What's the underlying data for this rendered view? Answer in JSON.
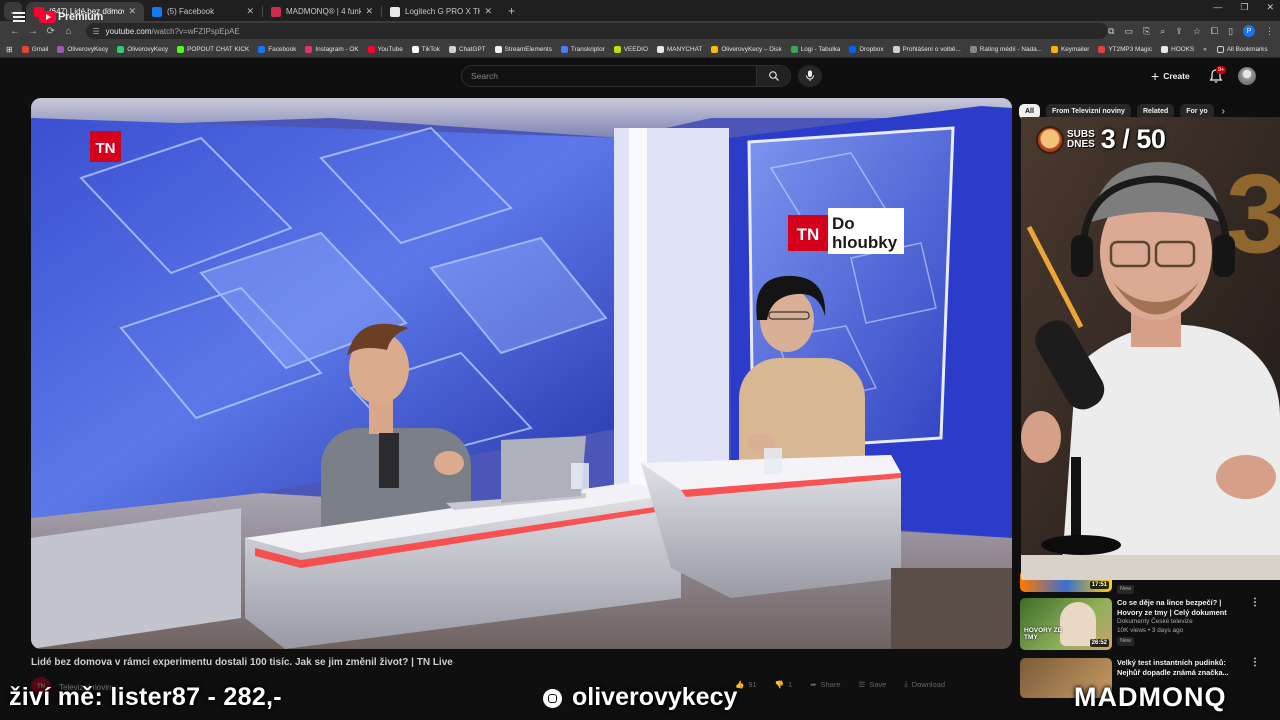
{
  "browser": {
    "tabs": [
      {
        "title": "(647) Lidé bez domova v rámci",
        "color": "#ff0033",
        "active": true
      },
      {
        "title": "(5) Facebook",
        "color": "#1877f2",
        "active": false
      },
      {
        "title": "MADMONQ® | 4 funkční doplň",
        "color": "#d12a4a",
        "active": false
      },
      {
        "title": "Logitech G PRO X TKL LIGHTSP",
        "color": "#e8e8e8",
        "active": false
      }
    ],
    "url_host": "youtube.com",
    "url_path": "/watch?v=wFZIPspEpAE",
    "profile_initial": "P",
    "bookmarks": [
      {
        "label": "Gmail",
        "color": "#ea4335"
      },
      {
        "label": "OliverovyKecy",
        "color": "#9b59b6"
      },
      {
        "label": "OliverovyKecy",
        "color": "#2ecc71"
      },
      {
        "label": "POPOUT CHAT KICK",
        "color": "#53fc18"
      },
      {
        "label": "Facebook",
        "color": "#1877f2"
      },
      {
        "label": "Instagram - OK",
        "color": "#e1306c"
      },
      {
        "label": "YouTube",
        "color": "#ff0033"
      },
      {
        "label": "TikTok",
        "color": "#ffffff"
      },
      {
        "label": "ChatGPT",
        "color": "#cfcfcf"
      },
      {
        "label": "StreamElements",
        "color": "#f2f2f2"
      },
      {
        "label": "Transkriptor",
        "color": "#4e7cff"
      },
      {
        "label": "VEEDIO",
        "color": "#c2e000"
      },
      {
        "label": "MANYCHAT",
        "color": "#e8e8e8"
      },
      {
        "label": "OliverovyKecy – Disk",
        "color": "#fbbc04"
      },
      {
        "label": "Logi - Tabulka",
        "color": "#34a853"
      },
      {
        "label": "Dropbox",
        "color": "#0061ff"
      },
      {
        "label": "Prohlášení o volbě...",
        "color": "#d0d0d0"
      },
      {
        "label": "Rating médií - Nada...",
        "color": "#888888"
      },
      {
        "label": "Keymailer",
        "color": "#ffb000"
      },
      {
        "label": "YT2MP3 Magic",
        "color": "#d44"
      },
      {
        "label": "HOOKS",
        "color": "#e8e8e8"
      }
    ],
    "all_bookmarks": "All Bookmarks"
  },
  "yt": {
    "logo_word": "Premium",
    "country": "CZ",
    "search_placeholder": "Search",
    "create_label": "Create",
    "notif_count": "9+"
  },
  "video": {
    "title": "Lidé bez domova v rámci experimentu dostali 100 tisíc. Jak se jim změnil život? | TN Live",
    "channel": "Televizní noviny",
    "channel_avatar": "TN",
    "likes": "91",
    "dislikes": "1",
    "share": "Share",
    "save": "Save",
    "download": "Download",
    "logo_tn": "TN",
    "screen_tn": "TN",
    "screen_line1": "Do",
    "screen_line2": "hloubky"
  },
  "sidebar": {
    "chips": [
      "All",
      "From Televizní noviny",
      "Related",
      "For yo"
    ],
    "recs": [
      {
        "title": "Co se děje na lince bezpečí? | Hovory ze tmy | Celý dokument",
        "channel": "Dokumenty České televize",
        "stats": "10K views • 3 days ago",
        "badge": "New",
        "duration": "26:52",
        "thumb_text": "HOVORY ZE TMY"
      },
      {
        "title": "Velký test instantních pudinků: Nejhůř dopadle známá značka...",
        "channel": "",
        "stats": "",
        "badge": "",
        "duration": "",
        "thumb_text": ""
      }
    ],
    "partial_duration": "17:51",
    "partial_badge": "New"
  },
  "overlay": {
    "left_text": "živí mě: lister87 - 282,-",
    "handle": "oliverovykecy",
    "brand": "MADMONQ",
    "subs_label_1": "SUBS",
    "subs_label_2": "DNES",
    "subs_count": "3 / 50",
    "balloon_number": "3"
  },
  "colors": {
    "yt_red": "#ff0033",
    "tn_red": "#d4001c",
    "studio_blue": "#3b4fd8"
  }
}
